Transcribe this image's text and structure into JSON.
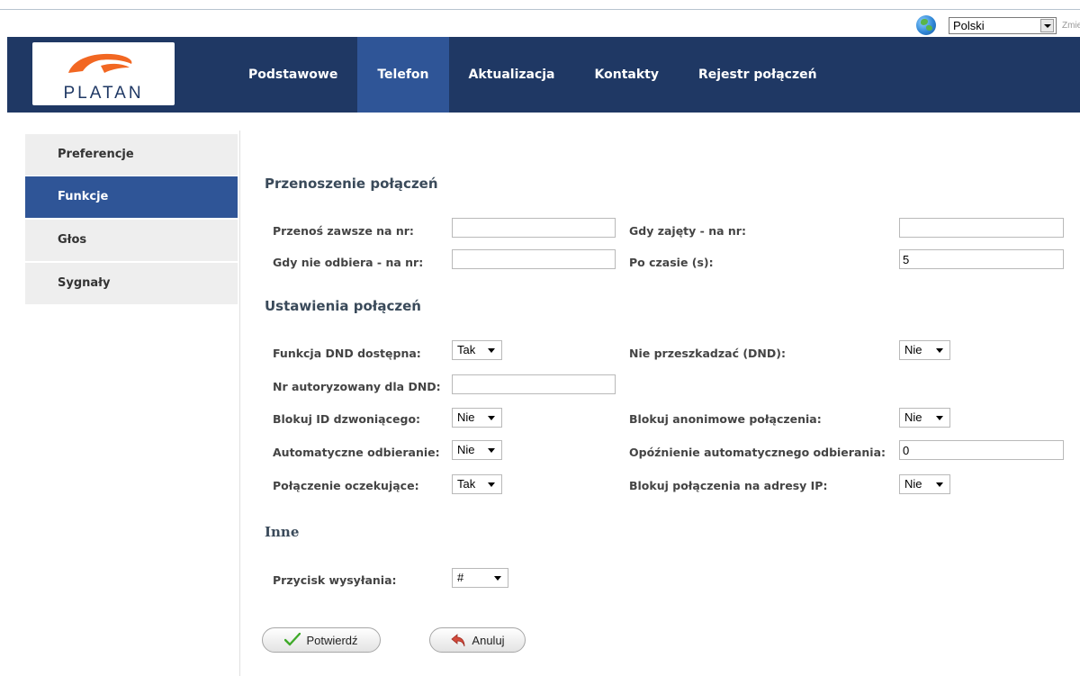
{
  "language": {
    "selected": "Polski",
    "change_label": "Zmień"
  },
  "logo": {
    "text": "PLATAN"
  },
  "nav": [
    {
      "label": "Podstawowe"
    },
    {
      "label": "Telefon"
    },
    {
      "label": "Aktualizacja"
    },
    {
      "label": "Kontakty"
    },
    {
      "label": "Rejestr połączeń"
    }
  ],
  "sidebar": [
    {
      "label": "Preferencje"
    },
    {
      "label": "Funkcje"
    },
    {
      "label": "Głos"
    },
    {
      "label": "Sygnały"
    }
  ],
  "forward": {
    "title": "Przenoszenie połączeń",
    "always_label": "Przenoś zawsze na nr:",
    "always_value": "",
    "busy_label": "Gdy zajęty - na nr:",
    "busy_value": "",
    "noanswer_label": "Gdy nie odbiera - na nr:",
    "noanswer_value": "",
    "timeout_label": "Po czasie (s):",
    "timeout_value": "5"
  },
  "settings": {
    "title": "Ustawienia połączeń",
    "dnd_available_label": "Funkcja DND dostępna:",
    "dnd_available_value": "Tak",
    "dnd_label": "Nie przeszkadzać (DND):",
    "dnd_value": "Nie",
    "dnd_auth_label": "Nr autoryzowany dla DND:",
    "dnd_auth_value": "",
    "block_callerid_label": "Blokuj ID dzwoniącego:",
    "block_callerid_value": "Nie",
    "block_anon_label": "Blokuj anonimowe połączenia:",
    "block_anon_value": "Nie",
    "auto_answer_label": "Automatyczne odbieranie:",
    "auto_answer_value": "Nie",
    "auto_answer_delay_label": "Opóźnienie automatycznego odbierania:",
    "auto_answer_delay_value": "0",
    "call_waiting_label": "Połączenie oczekujące:",
    "call_waiting_value": "Tak",
    "block_ip_label": "Blokuj połączenia na adresy IP:",
    "block_ip_value": "Nie"
  },
  "other": {
    "title": "Inne",
    "send_key_label": "Przycisk wysyłania:",
    "send_key_value": "#"
  },
  "buttons": {
    "confirm": "Potwierdź",
    "cancel": "Anuluj"
  },
  "colors": {
    "header_bg": "#1f3864",
    "accent": "#2f5597",
    "logo_orange": "#f26722"
  }
}
